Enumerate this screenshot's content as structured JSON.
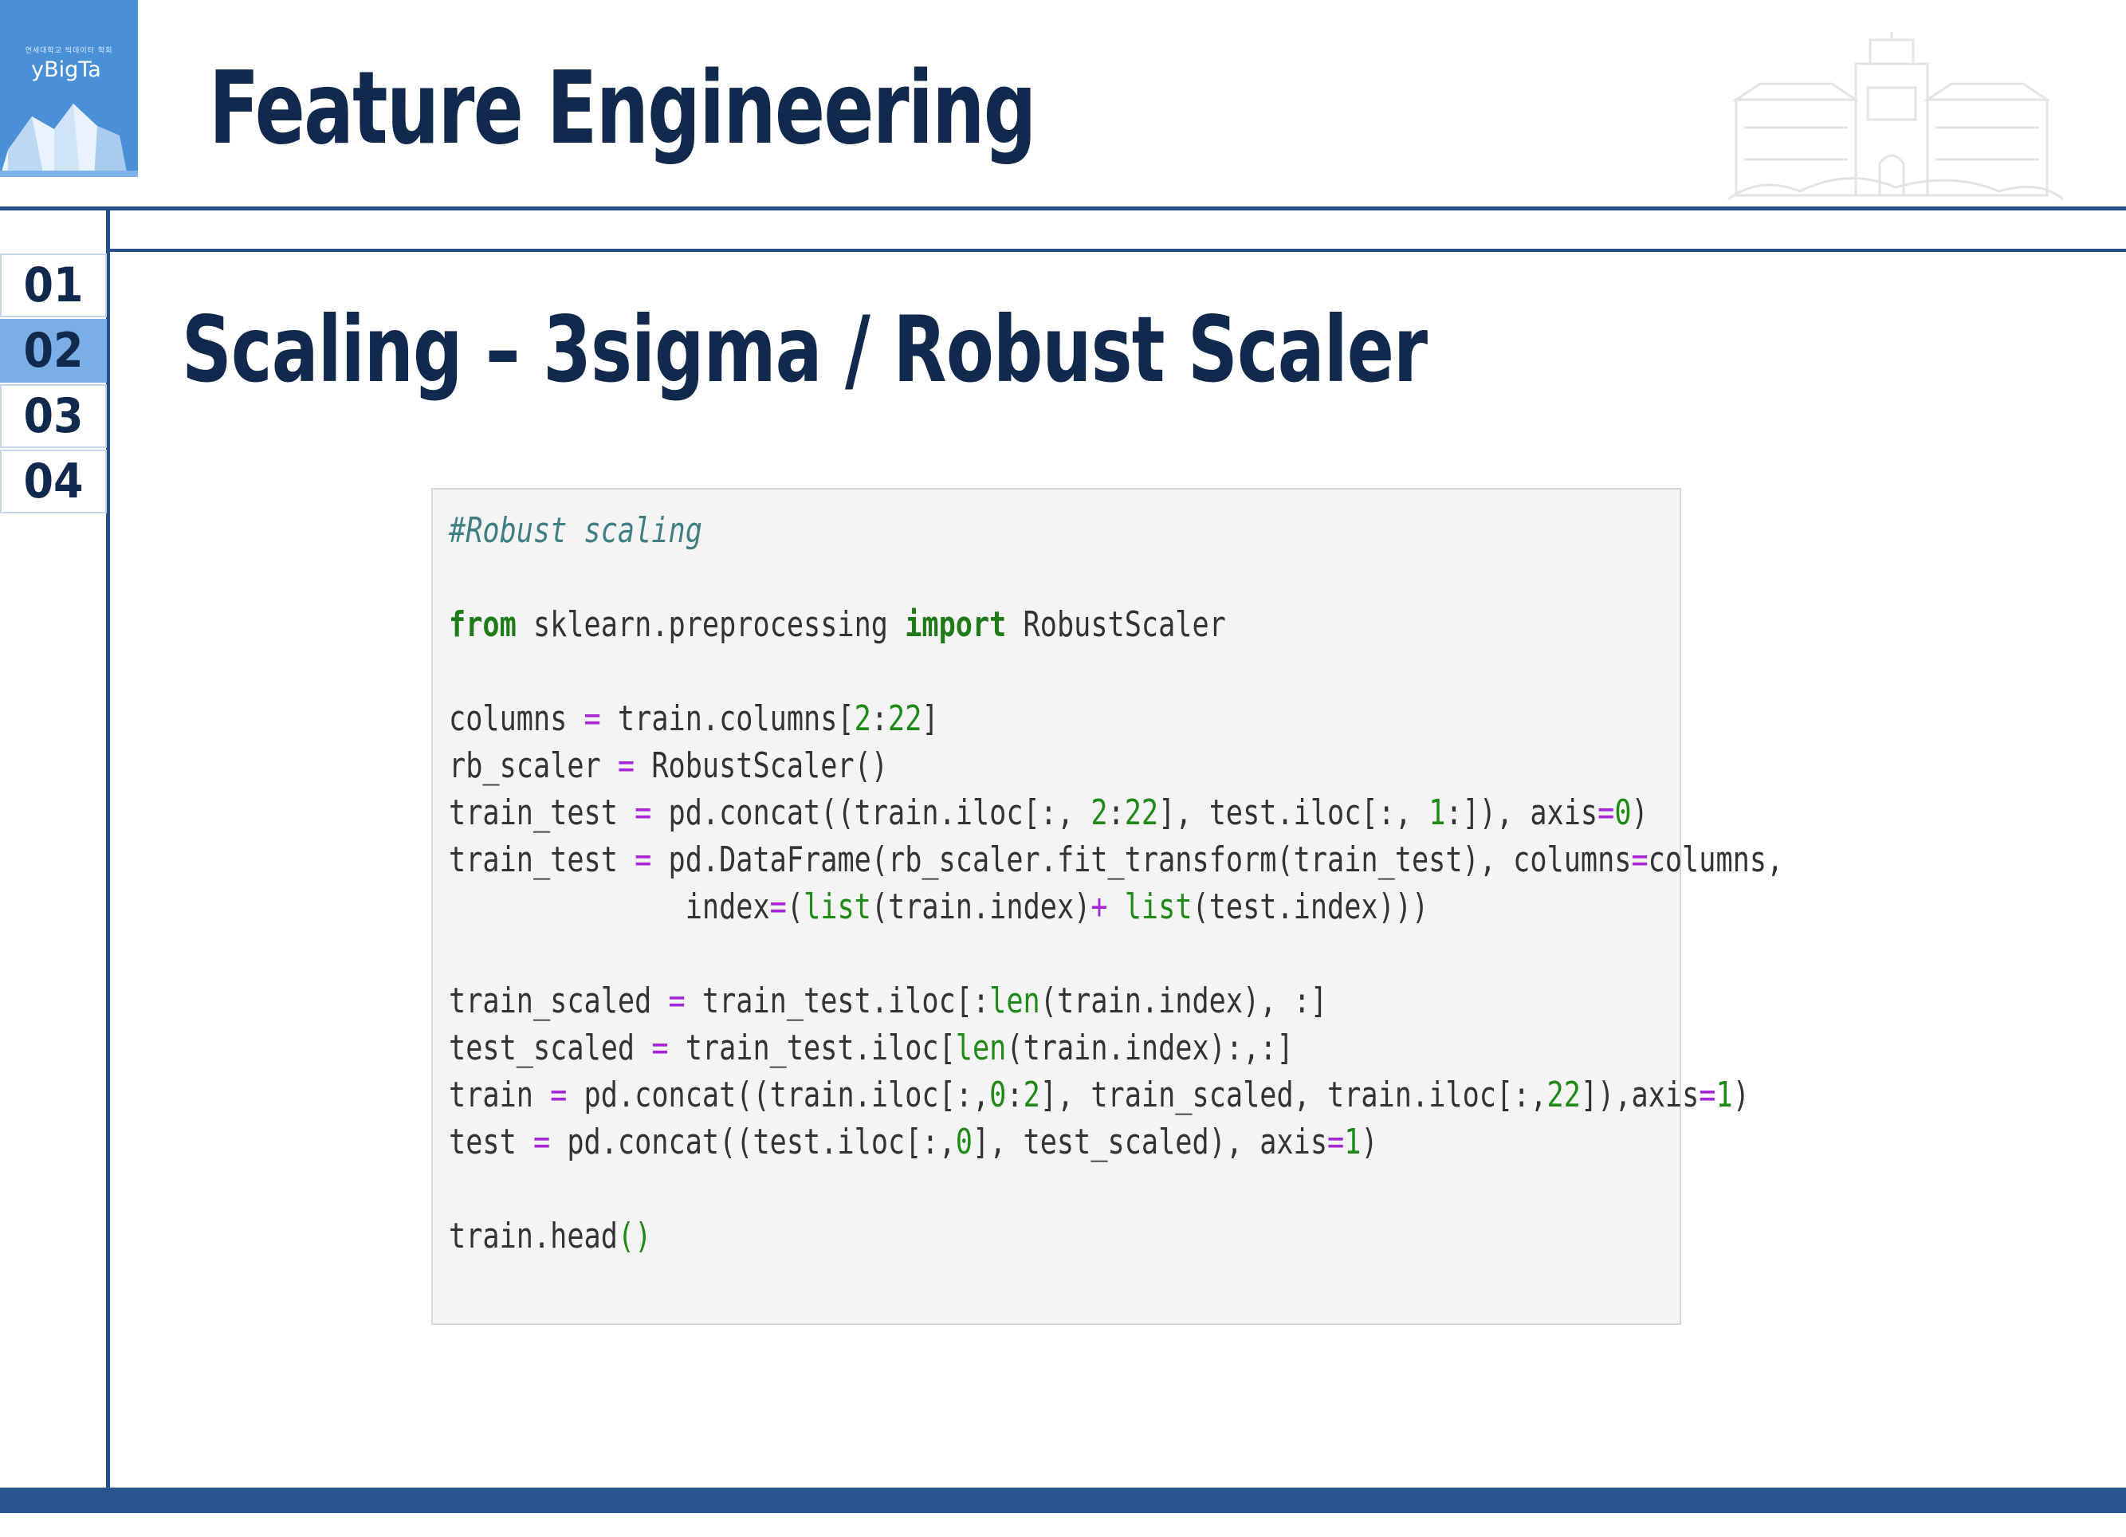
{
  "logo": {
    "small_text": "연세대학교 빅데이터 학회",
    "name": "yBigTa"
  },
  "header": {
    "title": "Feature Engineering"
  },
  "nav": {
    "items": [
      "01",
      "02",
      "03",
      "04"
    ],
    "active_index": 1
  },
  "slide": {
    "subtitle": "Scaling – 3sigma / Robust Scaler"
  },
  "colors": {
    "navy": "#11294d",
    "accent_blue": "#274f8a",
    "active_nav": "#7aaee6",
    "code_bg": "#f4f4f4"
  },
  "code": {
    "language": "python",
    "lines": [
      [
        {
          "t": "#Robust scaling",
          "c": "cm"
        }
      ],
      [],
      [
        {
          "t": "from",
          "c": "kw"
        },
        {
          "t": " sklearn.preprocessing ",
          "c": ""
        },
        {
          "t": "import",
          "c": "kw"
        },
        {
          "t": " RobustScaler",
          "c": ""
        }
      ],
      [],
      [
        {
          "t": "columns ",
          "c": ""
        },
        {
          "t": "=",
          "c": "op"
        },
        {
          "t": " train.columns[",
          "c": ""
        },
        {
          "t": "2",
          "c": "num"
        },
        {
          "t": ":",
          "c": ""
        },
        {
          "t": "22",
          "c": "num"
        },
        {
          "t": "]",
          "c": ""
        }
      ],
      [
        {
          "t": "rb_scaler ",
          "c": ""
        },
        {
          "t": "=",
          "c": "op"
        },
        {
          "t": " RobustScaler()",
          "c": ""
        }
      ],
      [
        {
          "t": "train_test ",
          "c": ""
        },
        {
          "t": "=",
          "c": "op"
        },
        {
          "t": " pd.concat((train.iloc[:, ",
          "c": ""
        },
        {
          "t": "2",
          "c": "num"
        },
        {
          "t": ":",
          "c": ""
        },
        {
          "t": "22",
          "c": "num"
        },
        {
          "t": "], test.iloc[:, ",
          "c": ""
        },
        {
          "t": "1",
          "c": "num"
        },
        {
          "t": ":]), axis",
          "c": ""
        },
        {
          "t": "=",
          "c": "op"
        },
        {
          "t": "0",
          "c": "num"
        },
        {
          "t": ")",
          "c": ""
        }
      ],
      [
        {
          "t": "train_test ",
          "c": ""
        },
        {
          "t": "=",
          "c": "op"
        },
        {
          "t": " pd.DataFrame(rb_scaler.fit_transform(train_test), columns",
          "c": ""
        },
        {
          "t": "=",
          "c": "op"
        },
        {
          "t": "columns,",
          "c": ""
        }
      ],
      [
        {
          "t": "              index",
          "c": ""
        },
        {
          "t": "=",
          "c": "op"
        },
        {
          "t": "(",
          "c": ""
        },
        {
          "t": "list",
          "c": "bi"
        },
        {
          "t": "(train.index)",
          "c": ""
        },
        {
          "t": "+",
          "c": "op"
        },
        {
          "t": " ",
          "c": ""
        },
        {
          "t": "list",
          "c": "bi"
        },
        {
          "t": "(test.index)))",
          "c": ""
        }
      ],
      [],
      [
        {
          "t": "train_scaled ",
          "c": ""
        },
        {
          "t": "=",
          "c": "op"
        },
        {
          "t": " train_test.iloc[:",
          "c": ""
        },
        {
          "t": "len",
          "c": "bi"
        },
        {
          "t": "(train.index), :]",
          "c": ""
        }
      ],
      [
        {
          "t": "test_scaled ",
          "c": ""
        },
        {
          "t": "=",
          "c": "op"
        },
        {
          "t": " train_test.iloc[",
          "c": ""
        },
        {
          "t": "len",
          "c": "bi"
        },
        {
          "t": "(train.index):,:]",
          "c": ""
        }
      ],
      [
        {
          "t": "train ",
          "c": ""
        },
        {
          "t": "=",
          "c": "op"
        },
        {
          "t": " pd.concat((train.iloc[:,",
          "c": ""
        },
        {
          "t": "0",
          "c": "num"
        },
        {
          "t": ":",
          "c": ""
        },
        {
          "t": "2",
          "c": "num"
        },
        {
          "t": "], train_scaled, train.iloc[:,",
          "c": ""
        },
        {
          "t": "22",
          "c": "num"
        },
        {
          "t": "]),axis",
          "c": ""
        },
        {
          "t": "=",
          "c": "op"
        },
        {
          "t": "1",
          "c": "num"
        },
        {
          "t": ")",
          "c": ""
        }
      ],
      [
        {
          "t": "test ",
          "c": ""
        },
        {
          "t": "=",
          "c": "op"
        },
        {
          "t": " pd.concat((test.iloc[:,",
          "c": ""
        },
        {
          "t": "0",
          "c": "num"
        },
        {
          "t": "], test_scaled), axis",
          "c": ""
        },
        {
          "t": "=",
          "c": "op"
        },
        {
          "t": "1",
          "c": "num"
        },
        {
          "t": ")",
          "c": ""
        }
      ],
      [],
      [
        {
          "t": "train.head",
          "c": ""
        },
        {
          "t": "()",
          "c": "num"
        }
      ]
    ]
  }
}
